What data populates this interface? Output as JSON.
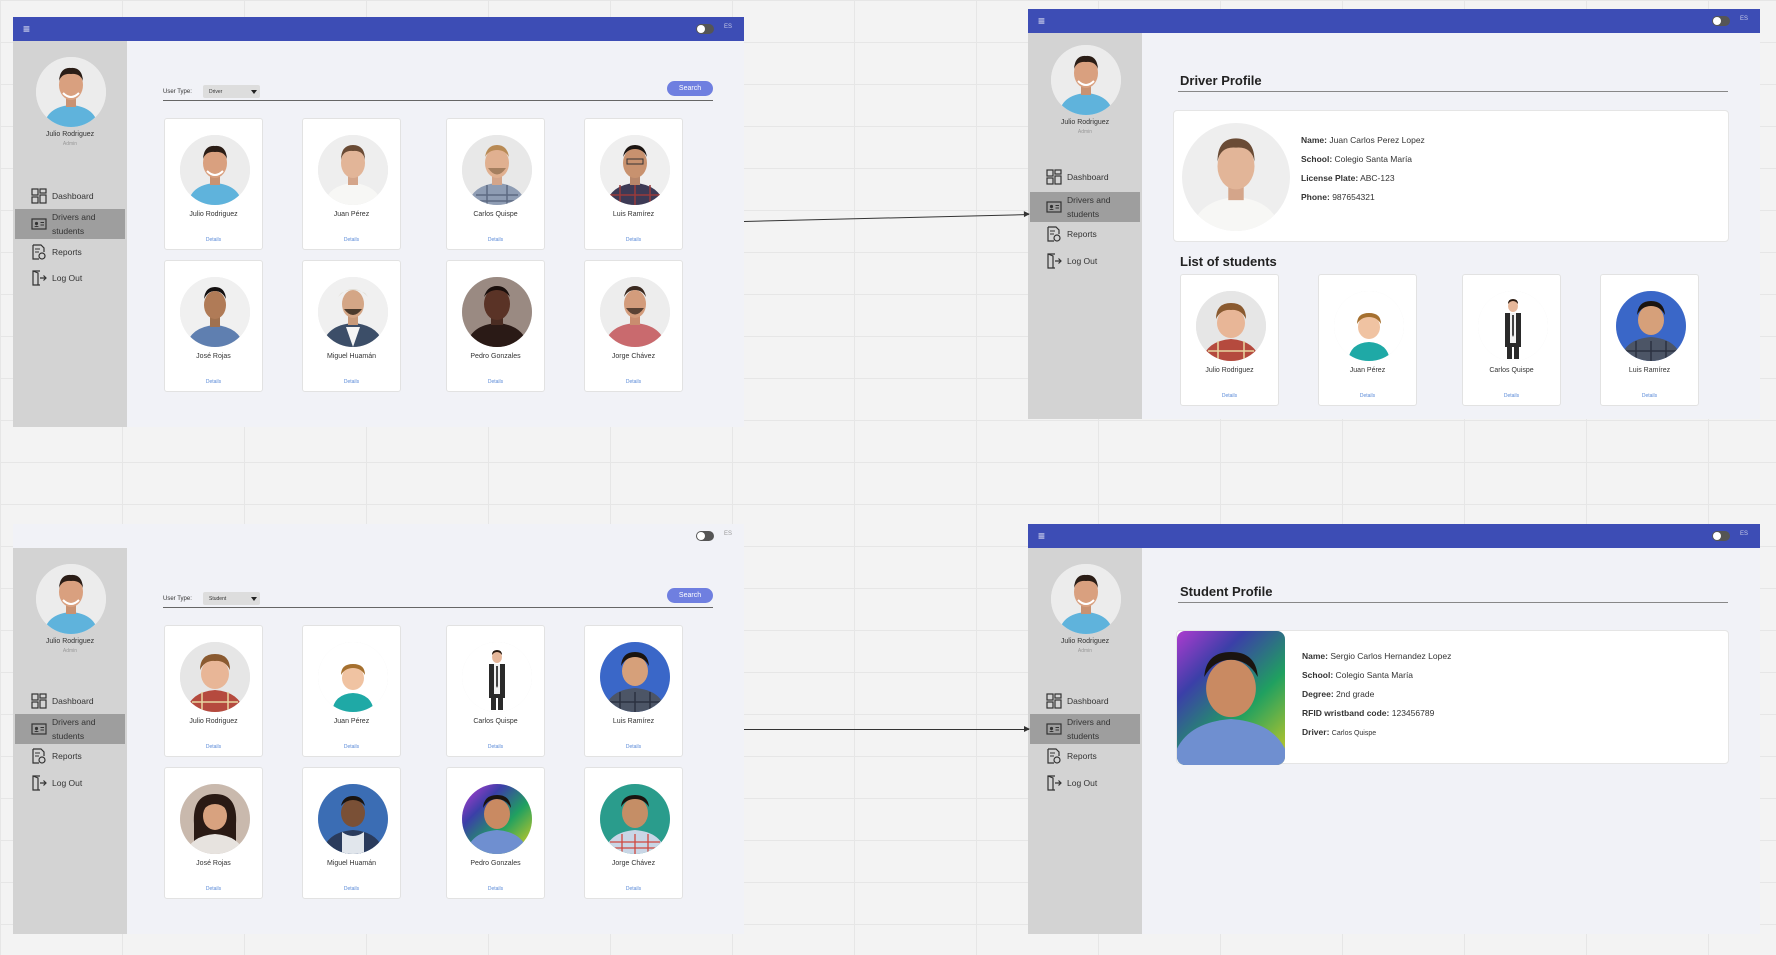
{
  "app": {
    "menu_glyph": "≡",
    "toggle_label": "ES",
    "user_name": "Julio Rodriguez",
    "user_role": "Admin",
    "nav": {
      "dashboard": "Dashboard",
      "drivers_students": "Drivers and students",
      "reports": "Reports",
      "logout": "Log Out"
    },
    "colors": {
      "topbar": "#3d4db5",
      "sidebar": "#d3d3d3",
      "accent": "#6f7fe0",
      "link": "#5a8ad8"
    }
  },
  "drivers_screen": {
    "user_type_label": "User Type:",
    "user_type_value": "Driver",
    "search_label": "Search",
    "cards": [
      {
        "name": "Julio Rodriguez",
        "details": "Details"
      },
      {
        "name": "Juan Pérez",
        "details": "Details"
      },
      {
        "name": "Carlos Quispe",
        "details": "Details"
      },
      {
        "name": "Luis Ramírez",
        "details": "Details"
      },
      {
        "name": "José Rojas",
        "details": "Details"
      },
      {
        "name": "Miguel Huamán",
        "details": "Details"
      },
      {
        "name": "Pedro Gonzales",
        "details": "Details"
      },
      {
        "name": "Jorge Chávez",
        "details": "Details"
      }
    ]
  },
  "students_screen": {
    "user_type_label": "User Type:",
    "user_type_value": "Student",
    "search_label": "Search",
    "cards": [
      {
        "name": "Julio Rodriguez",
        "details": "Details"
      },
      {
        "name": "Juan Pérez",
        "details": "Details"
      },
      {
        "name": "Carlos Quispe",
        "details": "Details"
      },
      {
        "name": "Luis Ramírez",
        "details": "Details"
      },
      {
        "name": "José Rojas",
        "details": "Details"
      },
      {
        "name": "Miguel Huamán",
        "details": "Details"
      },
      {
        "name": "Pedro Gonzales",
        "details": "Details"
      },
      {
        "name": "Jorge Chávez",
        "details": "Details"
      }
    ]
  },
  "driver_profile": {
    "title": "Driver Profile",
    "name_label": "Name:",
    "name_value": "Juan Carlos Perez Lopez",
    "school_label": "School:",
    "school_value": "Colegio Santa María",
    "plate_label": "License Plate:",
    "plate_value": "ABC-123",
    "phone_label": "Phone:",
    "phone_value": "987654321",
    "students_title": "List of students",
    "students": [
      {
        "name": "Julio Rodriguez",
        "details": "Details"
      },
      {
        "name": "Juan Pérez",
        "details": "Details"
      },
      {
        "name": "Carlos Quispe",
        "details": "Details"
      },
      {
        "name": "Luis Ramírez",
        "details": "Details"
      }
    ]
  },
  "student_profile": {
    "title": "Student Profile",
    "name_label": "Name:",
    "name_value": "Sergio Carlos Hernandez Lopez",
    "school_label": "School:",
    "school_value": "Colegio Santa María",
    "degree_label": "Degree:",
    "degree_value": "2nd grade",
    "rfid_label": "RFID wristband code:",
    "rfid_value": "123456789",
    "driver_label": "Driver:",
    "driver_value": "Carlos Quispe"
  }
}
